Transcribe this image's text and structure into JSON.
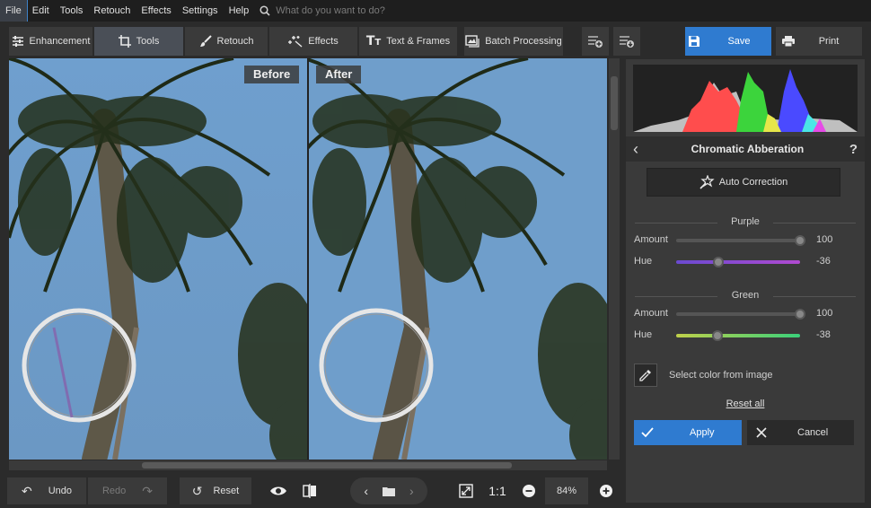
{
  "menu": {
    "items": [
      "File",
      "Edit",
      "Tools",
      "Retouch",
      "Effects",
      "Settings",
      "Help"
    ],
    "active": "File",
    "search_placeholder": "What do you want to do?"
  },
  "tabs": [
    {
      "label": "Enhancement",
      "icon": "sliders-icon"
    },
    {
      "label": "Tools",
      "icon": "crop-icon",
      "active": true
    },
    {
      "label": "Retouch",
      "icon": "brush-icon"
    },
    {
      "label": "Effects",
      "icon": "sparkle-icon"
    },
    {
      "label": "Text & Frames",
      "icon": "text-icon"
    }
  ],
  "toolbar": {
    "batch_label": "Batch Processing",
    "save_label": "Save",
    "print_label": "Print"
  },
  "viewport": {
    "before_label": "Before",
    "after_label": "After"
  },
  "bottom": {
    "undo_label": "Undo",
    "redo_label": "Redo",
    "reset_label": "Reset",
    "ratio_label": "1:1",
    "zoom_value": "84%"
  },
  "panel": {
    "title": "Chromatic Abberation",
    "help": "?",
    "auto_label": "Auto Correction",
    "purple": {
      "title": "Purple",
      "amount_label": "Amount",
      "amount_value": "100",
      "amount_frac": 1.0,
      "hue_label": "Hue",
      "hue_value": "-36",
      "hue_frac": 0.34
    },
    "green": {
      "title": "Green",
      "amount_label": "Amount",
      "amount_value": "100",
      "amount_frac": 1.0,
      "hue_label": "Hue",
      "hue_value": "-38",
      "hue_frac": 0.33
    },
    "eyedrop_label": "Select color from image",
    "reset_all_label": "Reset all",
    "apply_label": "Apply",
    "cancel_label": "Cancel"
  },
  "colors": {
    "accent": "#2f7bd0",
    "sky": "#6f9cc8"
  }
}
